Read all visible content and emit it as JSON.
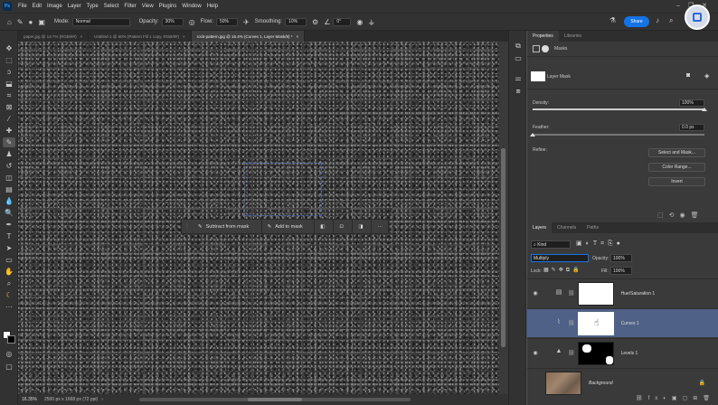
{
  "app": {
    "logo": "Ps"
  },
  "menu": [
    "File",
    "Edit",
    "Image",
    "Layer",
    "Type",
    "Select",
    "Filter",
    "View",
    "Plugins",
    "Window",
    "Help"
  ],
  "options": {
    "mode_label": "Mode:",
    "mode_value": "Normal",
    "opacity_label": "Opacity:",
    "opacity_value": "30%",
    "flow_label": "Flow:",
    "flow_value": "50%",
    "smoothing_label": "Smoothing:",
    "smoothing_value": "10%",
    "angle_value": "0°",
    "share_label": "Share"
  },
  "tabs": [
    {
      "label": "paper.jpg @ 13.7% (RGB/8#)",
      "active": false
    },
    {
      "label": "Untitled-1 @ 50% (Pattern Fill 1 copy, RGB/8#)",
      "active": false
    },
    {
      "label": "rock-pattern.jpg @ 16.4% (Curves 1, Layer Mask/8) *",
      "active": true
    }
  ],
  "context_bar": {
    "subtract_label": "Subtract from mask",
    "add_label": "Add to mask",
    "more": "···"
  },
  "status": {
    "zoom": "16.35%",
    "doc": "2500 px x 1668 px (72 ppi)"
  },
  "properties": {
    "tabs": [
      "Properties",
      "Libraries"
    ],
    "section": "Masks",
    "mask_label": "Layer Mask",
    "density_label": "Density:",
    "density_value": "100%",
    "density_fraction": 1.0,
    "feather_label": "Feather:",
    "feather_value": "0.0 px",
    "feather_fraction": 0.0,
    "refine_label": "Refine:",
    "buttons": [
      "Select and Mask...",
      "Color Range...",
      "Invert"
    ]
  },
  "layers_panel": {
    "tabs": [
      "Layers",
      "Channels",
      "Paths"
    ],
    "kind_label": "Kind",
    "blend_mode": "Multiply",
    "opacity_label": "Opacity:",
    "opacity_value": "100%",
    "lock_label": "Lock:",
    "fill_label": "Fill:",
    "fill_value": "100%",
    "layers": [
      {
        "name": "Hue/Saturation 1",
        "selected": false
      },
      {
        "name": "Curves 1",
        "selected": true
      },
      {
        "name": "Levels 1",
        "selected": false
      },
      {
        "name": "Background",
        "selected": false
      }
    ]
  },
  "colors": {
    "accent": "#1473e6",
    "selected_layer": "#4f6186",
    "selection_outline": "#4a63b0"
  }
}
